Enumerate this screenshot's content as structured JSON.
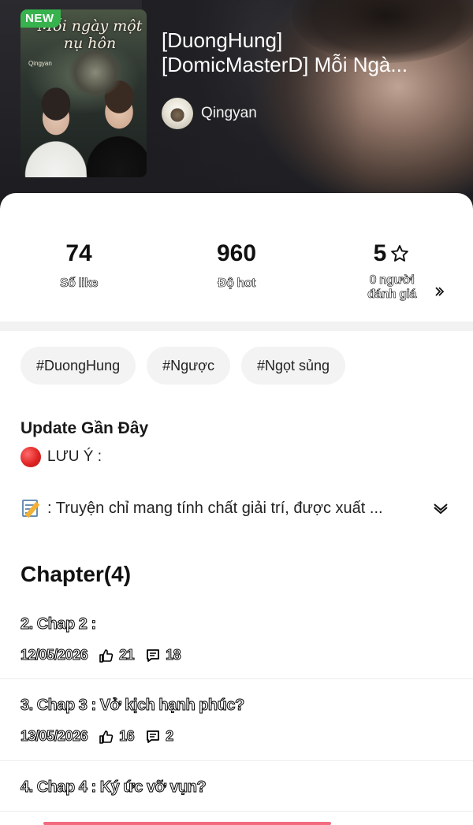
{
  "header": {
    "badge": "NEW",
    "cover_title": "Mỗi ngày một nụ hôn",
    "cover_author": "Qingyan",
    "title_line1": "[DuongHung]",
    "title_line2": "[DomicMasterD] Mỗi Ngà...",
    "author_name": "Qingyan"
  },
  "stats": {
    "likes": {
      "value": "74",
      "label": "Số like"
    },
    "hot": {
      "value": "960",
      "label": "Độ hot"
    },
    "rating": {
      "value": "5",
      "label_line1": "0 người",
      "label_line2": "đánh giá"
    }
  },
  "tags": [
    "#DuongHung",
    "#Ngược",
    "#Ngọt sủng"
  ],
  "update": {
    "title": "Update Gần Đây",
    "note": "LƯU Ý :",
    "desc": ": Truyện chỉ mang tính chất giải trí, được xuất ..."
  },
  "chapters": {
    "heading": "Chapter(4)",
    "items": [
      {
        "title": "2. Chap 2 :",
        "date": "12/05/2026",
        "likes": "21",
        "comments": "18"
      },
      {
        "title": "3. Chap 3 : Vở kịch hạnh phúc?",
        "date": "13/05/2026",
        "likes": "16",
        "comments": "2"
      },
      {
        "title": "4. Chap 4 : Ký ức vỡ vụn?"
      }
    ]
  },
  "colors": {
    "badge_green": "#37b24d",
    "tag_bg": "#f3f3f3",
    "accent_red": "#e02424",
    "bottom_bar": "#f36b7f"
  },
  "icons": {
    "star": "star-outline-icon",
    "chevron_right": "chevron-right-icon",
    "chevron_down": "chevron-down-icon",
    "like": "thumbs-up-icon",
    "comment": "comment-icon",
    "memo": "memo-icon",
    "dot": "red-circle-icon"
  }
}
